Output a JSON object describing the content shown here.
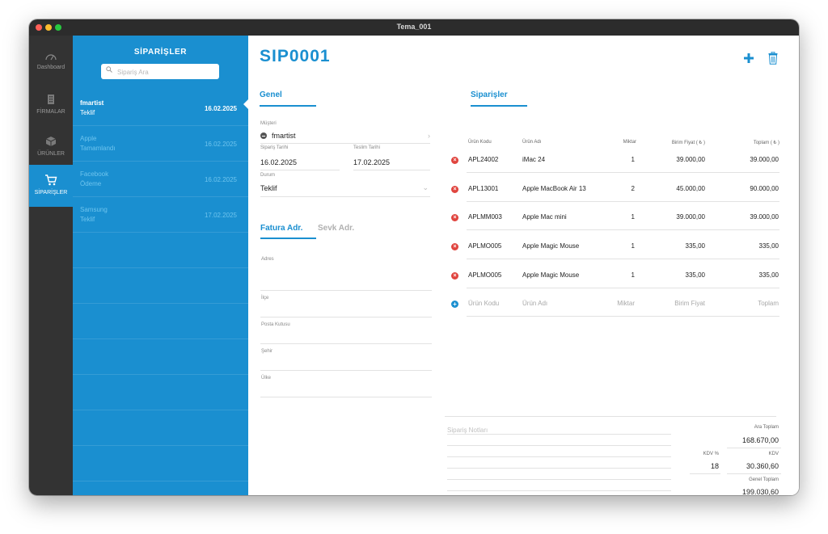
{
  "window": {
    "title": "Tema_001"
  },
  "nav": [
    {
      "label": "Dashboard",
      "icon": "gauge-icon"
    },
    {
      "label": "FİRMALAR",
      "icon": "building-icon"
    },
    {
      "label": "ÜRÜNLER",
      "icon": "box-icon"
    },
    {
      "label": "SİPARİŞLER",
      "icon": "cart-icon",
      "active": true
    }
  ],
  "orders_panel": {
    "title": "SİPARİŞLER",
    "search_placeholder": "Sipariş Ara",
    "items": [
      {
        "name": "fmartist",
        "status": "Teklif",
        "date": "16.02.2025"
      },
      {
        "name": "Apple",
        "status": "Tamamlandı",
        "date": "16.02.2025"
      },
      {
        "name": "Facebook",
        "status": "Ödeme",
        "date": "16.02.2025"
      },
      {
        "name": "Samsung",
        "status": "Teklif",
        "date": "17.02.2025"
      }
    ]
  },
  "order": {
    "code": "SIP0001",
    "general": {
      "title": "Genel",
      "customer_label": "Müşteri",
      "customer": "fmartist",
      "order_date_label": "Sipariş Tarihi",
      "order_date": "16.02.2025",
      "delivery_date_label": "Teslim Tarihi",
      "delivery_date": "17.02.2025",
      "status_label": "Durum",
      "status": "Teklif"
    },
    "address": {
      "tab_invoice": "Fatura Adr.",
      "tab_shipping": "Sevk Adr.",
      "fields": [
        "Adres",
        "İlçe",
        "Posta Kutusu",
        "Şehir",
        "Ülke"
      ]
    },
    "items_section": {
      "title": "Siparişler",
      "headers": [
        "Ürün Kodu",
        "Ürün Adı",
        "Miktar",
        "Birim Fiyat ( ₺ )",
        "Toplam ( ₺ )"
      ],
      "rows": [
        {
          "code": "APL24002",
          "name": "iMac 24",
          "qty": "1",
          "price": "39.000,00",
          "total": "39.000,00"
        },
        {
          "code": "APL13001",
          "name": "Apple MacBook Air 13",
          "qty": "2",
          "price": "45.000,00",
          "total": "90.000,00"
        },
        {
          "code": "APLMM003",
          "name": "Apple Mac mini",
          "qty": "1",
          "price": "39.000,00",
          "total": "39.000,00"
        },
        {
          "code": "APLMO005",
          "name": "Apple Magic Mouse",
          "qty": "1",
          "price": "335,00",
          "total": "335,00"
        },
        {
          "code": "APLMO005",
          "name": "Apple Magic Mouse",
          "qty": "1",
          "price": "335,00",
          "total": "335,00"
        }
      ],
      "new_row_placeholders": {
        "code": "Ürün Kodu",
        "name": "Ürün Adı",
        "qty": "Miktar",
        "price": "Birim Fiyat",
        "total": "Toplam"
      }
    },
    "notes_placeholder": "Sipariş Notları",
    "totals": {
      "subtotal_label": "Ara Toplam",
      "subtotal": "168.670,00",
      "vat_rate_label": "KDV %",
      "vat_rate": "18",
      "vat_label": "KDV",
      "vat": "30.360,60",
      "grand_label": "Genel Toplam",
      "grand": "199.030,60"
    }
  },
  "colors": {
    "accent": "#1a8fd0",
    "sidebar": "#333333",
    "remove": "#e0443e"
  }
}
